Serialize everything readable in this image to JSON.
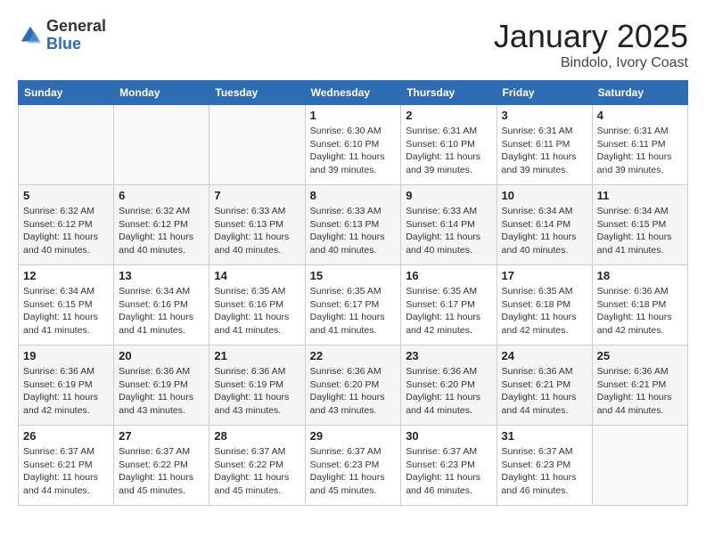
{
  "header": {
    "logo_general": "General",
    "logo_blue": "Blue",
    "month": "January 2025",
    "location": "Bindolo, Ivory Coast"
  },
  "days_of_week": [
    "Sunday",
    "Monday",
    "Tuesday",
    "Wednesday",
    "Thursday",
    "Friday",
    "Saturday"
  ],
  "weeks": [
    [
      {
        "day": "",
        "info": ""
      },
      {
        "day": "",
        "info": ""
      },
      {
        "day": "",
        "info": ""
      },
      {
        "day": "1",
        "info": "Sunrise: 6:30 AM\nSunset: 6:10 PM\nDaylight: 11 hours and 39 minutes."
      },
      {
        "day": "2",
        "info": "Sunrise: 6:31 AM\nSunset: 6:10 PM\nDaylight: 11 hours and 39 minutes."
      },
      {
        "day": "3",
        "info": "Sunrise: 6:31 AM\nSunset: 6:11 PM\nDaylight: 11 hours and 39 minutes."
      },
      {
        "day": "4",
        "info": "Sunrise: 6:31 AM\nSunset: 6:11 PM\nDaylight: 11 hours and 39 minutes."
      }
    ],
    [
      {
        "day": "5",
        "info": "Sunrise: 6:32 AM\nSunset: 6:12 PM\nDaylight: 11 hours and 40 minutes."
      },
      {
        "day": "6",
        "info": "Sunrise: 6:32 AM\nSunset: 6:12 PM\nDaylight: 11 hours and 40 minutes."
      },
      {
        "day": "7",
        "info": "Sunrise: 6:33 AM\nSunset: 6:13 PM\nDaylight: 11 hours and 40 minutes."
      },
      {
        "day": "8",
        "info": "Sunrise: 6:33 AM\nSunset: 6:13 PM\nDaylight: 11 hours and 40 minutes."
      },
      {
        "day": "9",
        "info": "Sunrise: 6:33 AM\nSunset: 6:14 PM\nDaylight: 11 hours and 40 minutes."
      },
      {
        "day": "10",
        "info": "Sunrise: 6:34 AM\nSunset: 6:14 PM\nDaylight: 11 hours and 40 minutes."
      },
      {
        "day": "11",
        "info": "Sunrise: 6:34 AM\nSunset: 6:15 PM\nDaylight: 11 hours and 41 minutes."
      }
    ],
    [
      {
        "day": "12",
        "info": "Sunrise: 6:34 AM\nSunset: 6:15 PM\nDaylight: 11 hours and 41 minutes."
      },
      {
        "day": "13",
        "info": "Sunrise: 6:34 AM\nSunset: 6:16 PM\nDaylight: 11 hours and 41 minutes."
      },
      {
        "day": "14",
        "info": "Sunrise: 6:35 AM\nSunset: 6:16 PM\nDaylight: 11 hours and 41 minutes."
      },
      {
        "day": "15",
        "info": "Sunrise: 6:35 AM\nSunset: 6:17 PM\nDaylight: 11 hours and 41 minutes."
      },
      {
        "day": "16",
        "info": "Sunrise: 6:35 AM\nSunset: 6:17 PM\nDaylight: 11 hours and 42 minutes."
      },
      {
        "day": "17",
        "info": "Sunrise: 6:35 AM\nSunset: 6:18 PM\nDaylight: 11 hours and 42 minutes."
      },
      {
        "day": "18",
        "info": "Sunrise: 6:36 AM\nSunset: 6:18 PM\nDaylight: 11 hours and 42 minutes."
      }
    ],
    [
      {
        "day": "19",
        "info": "Sunrise: 6:36 AM\nSunset: 6:19 PM\nDaylight: 11 hours and 42 minutes."
      },
      {
        "day": "20",
        "info": "Sunrise: 6:36 AM\nSunset: 6:19 PM\nDaylight: 11 hours and 43 minutes."
      },
      {
        "day": "21",
        "info": "Sunrise: 6:36 AM\nSunset: 6:19 PM\nDaylight: 11 hours and 43 minutes."
      },
      {
        "day": "22",
        "info": "Sunrise: 6:36 AM\nSunset: 6:20 PM\nDaylight: 11 hours and 43 minutes."
      },
      {
        "day": "23",
        "info": "Sunrise: 6:36 AM\nSunset: 6:20 PM\nDaylight: 11 hours and 44 minutes."
      },
      {
        "day": "24",
        "info": "Sunrise: 6:36 AM\nSunset: 6:21 PM\nDaylight: 11 hours and 44 minutes."
      },
      {
        "day": "25",
        "info": "Sunrise: 6:36 AM\nSunset: 6:21 PM\nDaylight: 11 hours and 44 minutes."
      }
    ],
    [
      {
        "day": "26",
        "info": "Sunrise: 6:37 AM\nSunset: 6:21 PM\nDaylight: 11 hours and 44 minutes."
      },
      {
        "day": "27",
        "info": "Sunrise: 6:37 AM\nSunset: 6:22 PM\nDaylight: 11 hours and 45 minutes."
      },
      {
        "day": "28",
        "info": "Sunrise: 6:37 AM\nSunset: 6:22 PM\nDaylight: 11 hours and 45 minutes."
      },
      {
        "day": "29",
        "info": "Sunrise: 6:37 AM\nSunset: 6:23 PM\nDaylight: 11 hours and 45 minutes."
      },
      {
        "day": "30",
        "info": "Sunrise: 6:37 AM\nSunset: 6:23 PM\nDaylight: 11 hours and 46 minutes."
      },
      {
        "day": "31",
        "info": "Sunrise: 6:37 AM\nSunset: 6:23 PM\nDaylight: 11 hours and 46 minutes."
      },
      {
        "day": "",
        "info": ""
      }
    ]
  ]
}
